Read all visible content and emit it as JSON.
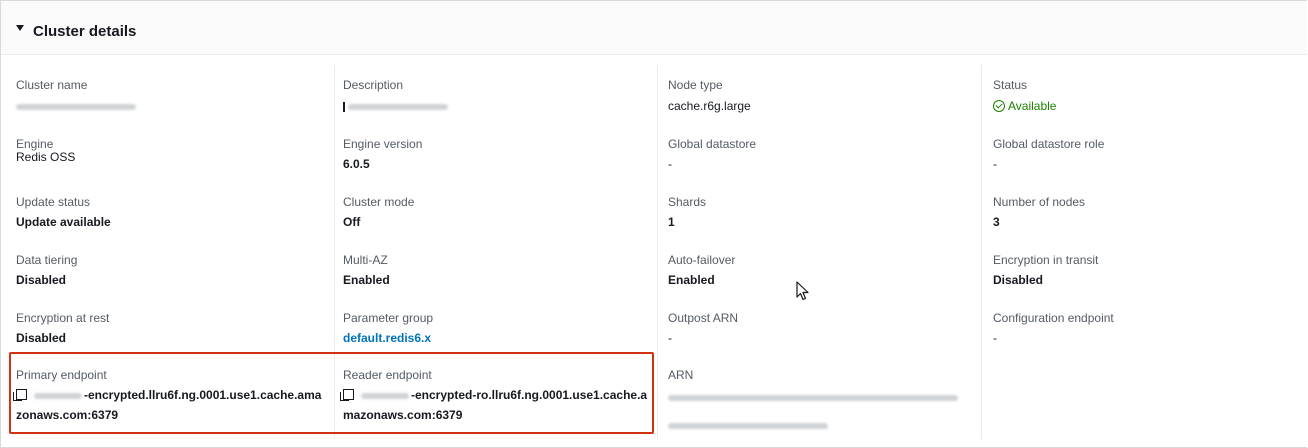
{
  "panel": {
    "title": "Cluster details"
  },
  "fields": {
    "cluster_name": {
      "label": "Cluster name"
    },
    "description": {
      "label": "Description"
    },
    "node_type": {
      "label": "Node type",
      "value": "cache.r6g.large"
    },
    "status": {
      "label": "Status",
      "value": "Available",
      "color": "#1d8102"
    },
    "engine": {
      "label": "Engine",
      "value": "Redis OSS"
    },
    "engine_version": {
      "label": "Engine version",
      "value": "6.0.5"
    },
    "global_datastore": {
      "label": "Global datastore",
      "value": "-"
    },
    "global_datastore_role": {
      "label": "Global datastore role",
      "value": "-"
    },
    "update_status": {
      "label": "Update status",
      "value": "Update available"
    },
    "cluster_mode": {
      "label": "Cluster mode",
      "value": "Off"
    },
    "shards": {
      "label": "Shards",
      "value": "1"
    },
    "number_of_nodes": {
      "label": "Number of nodes",
      "value": "3"
    },
    "data_tiering": {
      "label": "Data tiering",
      "value": "Disabled"
    },
    "multi_az": {
      "label": "Multi-AZ",
      "value": "Enabled"
    },
    "auto_failover": {
      "label": "Auto-failover",
      "value": "Enabled"
    },
    "encryption_in_transit": {
      "label": "Encryption in transit",
      "value": "Disabled"
    },
    "encryption_at_rest": {
      "label": "Encryption at rest",
      "value": "Disabled"
    },
    "parameter_group": {
      "label": "Parameter group",
      "value": "default.redis6.x"
    },
    "outpost_arn": {
      "label": "Outpost ARN",
      "value": "-"
    },
    "configuration_endpoint": {
      "label": "Configuration endpoint",
      "value": "-"
    },
    "primary_endpoint": {
      "label": "Primary endpoint",
      "value_line1": "-encrypted.llru6f.ng.0001.use1.cache.ama",
      "value_line2": "zonaws.com:6379"
    },
    "reader_endpoint": {
      "label": "Reader endpoint",
      "value_line1": "-encrypted-ro.llru6f.ng.0001.use1.cache.a",
      "value_line2": "mazonaws.com:6379"
    },
    "arn": {
      "label": "ARN"
    }
  },
  "colors": {
    "highlight": "#d13212",
    "link": "#0073bb",
    "status_ok": "#1d8102"
  },
  "icons": {
    "toggle": "caret-down-icon",
    "status": "check-circle-icon",
    "copy": "copy-icon",
    "cursor": "mouse-pointer-icon"
  }
}
